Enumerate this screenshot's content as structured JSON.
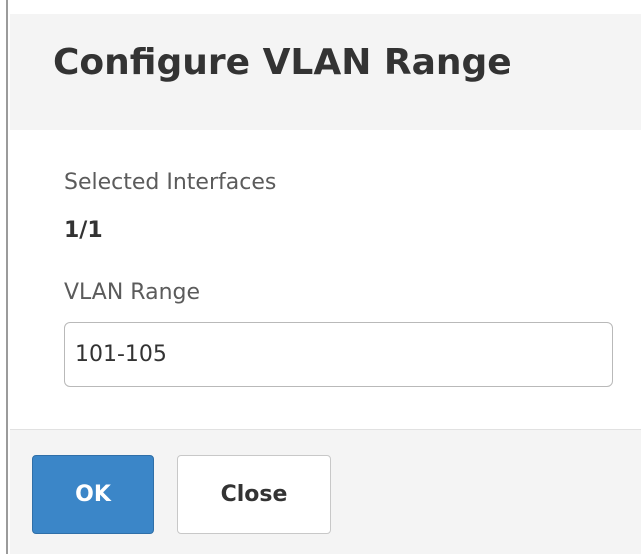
{
  "dialog": {
    "title": "Configure VLAN Range"
  },
  "form": {
    "selected_interfaces_label": "Selected Interfaces",
    "selected_interfaces_value": "1/1",
    "vlan_range_label": "VLAN Range",
    "vlan_range_value": "101-105"
  },
  "footer": {
    "ok_label": "OK",
    "close_label": "Close"
  },
  "colors": {
    "primary_button": "#3b86c8",
    "header_background": "#f4f4f4"
  }
}
